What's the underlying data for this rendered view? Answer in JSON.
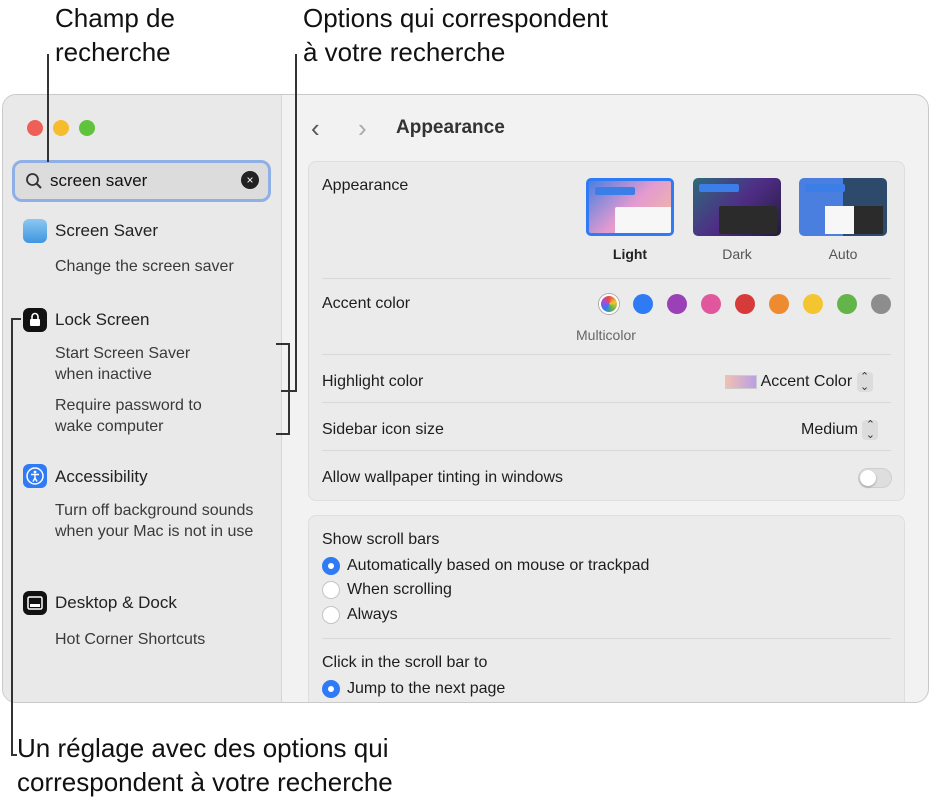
{
  "callouts": {
    "search_field": [
      "Champ de",
      "recherche"
    ],
    "matching_options": [
      "Options qui correspondent",
      "à votre recherche"
    ],
    "matching_setting": [
      "Un réglage avec des options qui",
      "correspondent à votre recherche"
    ]
  },
  "search": {
    "value": "screen saver"
  },
  "sidebar": {
    "items": [
      {
        "label": "Screen Saver",
        "subs": [
          "Change the screen saver"
        ]
      },
      {
        "label": "Lock Screen",
        "subs": [
          "Start Screen Saver when inactive",
          "Require password to wake computer"
        ]
      },
      {
        "label": "Accessibility",
        "subs": [
          "Turn off background sounds when your Mac is not in use"
        ]
      },
      {
        "label": "Desktop & Dock",
        "subs": [
          "Hot Corner Shortcuts"
        ]
      }
    ]
  },
  "main": {
    "title": "Appearance",
    "appearance_label": "Appearance",
    "themes": [
      "Light",
      "Dark",
      "Auto"
    ],
    "selected_theme": "Light",
    "accent_label": "Accent color",
    "accent_caption": "Multicolor",
    "accent_colors": [
      "#a04ee0",
      "#2f7bf5",
      "#9a41b8",
      "#e0579e",
      "#d63a3a",
      "#ee8a2f",
      "#f3c531",
      "#63b549",
      "#8d8d8d"
    ],
    "highlight_label": "Highlight color",
    "highlight_value": "Accent Color",
    "sidebar_icon_label": "Sidebar icon size",
    "sidebar_icon_value": "Medium",
    "tinting_label": "Allow wallpaper tinting in windows",
    "tinting_on": false,
    "scroll_title": "Show scroll bars",
    "scroll_options": [
      "Automatically based on mouse or trackpad",
      "When scrolling",
      "Always"
    ],
    "click_title": "Click in the scroll bar to",
    "click_option": "Jump to the next page"
  }
}
